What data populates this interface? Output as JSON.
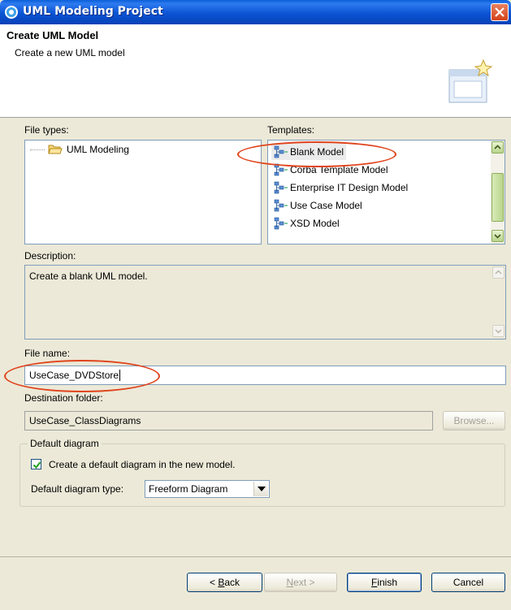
{
  "window": {
    "title": "UML Modeling Project"
  },
  "header": {
    "title": "Create UML Model",
    "subtitle": "Create a new UML model"
  },
  "file_types": {
    "label": "File types:",
    "items": [
      {
        "label": "UML Modeling"
      }
    ]
  },
  "templates": {
    "label": "Templates:",
    "items": [
      {
        "label": "Blank Model",
        "selected": true
      },
      {
        "label": "Corba Template Model"
      },
      {
        "label": "Enterprise IT Design Model"
      },
      {
        "label": "Use Case Model"
      },
      {
        "label": "XSD Model"
      }
    ]
  },
  "description": {
    "label": "Description:",
    "text": "Create a blank UML model."
  },
  "file_name": {
    "label": "File name:",
    "value": "UseCase_DVDStore"
  },
  "destination": {
    "label": "Destination folder:",
    "value": "UseCase_ClassDiagrams",
    "browse_label": "Browse..."
  },
  "default_diagram": {
    "group_label": "Default diagram",
    "checkbox_label": "Create a default diagram in the new model.",
    "checkbox_checked": true,
    "type_label": "Default diagram type:",
    "type_value": "Freeform Diagram"
  },
  "buttons": {
    "back_prefix": "< ",
    "back_mnemonic": "B",
    "back_rest": "ack",
    "next_prefix": "",
    "next_mnemonic": "N",
    "next_rest": "ext >",
    "finish_mnemonic": "F",
    "finish_rest": "inish",
    "cancel": "Cancel"
  },
  "colors": {
    "annotation": "#e0431b",
    "titlebar": "#0b54d4"
  }
}
